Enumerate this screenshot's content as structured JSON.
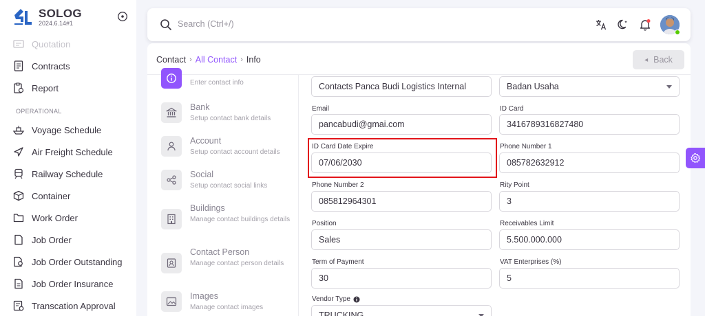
{
  "brand": {
    "name": "SOLOG",
    "version": "2024.6.14#1"
  },
  "sidebar": {
    "items": [
      {
        "label": "Quotation",
        "icon": "quotation-icon"
      },
      {
        "label": "Contracts",
        "icon": "contracts-icon"
      },
      {
        "label": "Report",
        "icon": "report-icon"
      },
      {
        "label": "Voyage Schedule",
        "icon": "ship-icon"
      },
      {
        "label": "Air Freight Schedule",
        "icon": "plane-icon"
      },
      {
        "label": "Railway Schedule",
        "icon": "train-icon"
      },
      {
        "label": "Container",
        "icon": "container-icon"
      },
      {
        "label": "Work Order",
        "icon": "folder-icon"
      },
      {
        "label": "Job Order",
        "icon": "file-icon"
      },
      {
        "label": "Job Order Outstanding",
        "icon": "file-search-icon"
      },
      {
        "label": "Job Order Insurance",
        "icon": "file-text-icon"
      },
      {
        "label": "Transcation Approval",
        "icon": "approval-icon"
      }
    ],
    "section_operational": "OPERATIONAL"
  },
  "search": {
    "placeholder": "Search (Ctrl+/)"
  },
  "breadcrumb": {
    "root": "Contact",
    "link": "All Contact",
    "current": "Info"
  },
  "back_label": "Back",
  "steps": [
    {
      "title": "",
      "desc": "Enter contact info"
    },
    {
      "title": "Bank",
      "desc": "Setup contact bank details"
    },
    {
      "title": "Account",
      "desc": "Setup contact account details"
    },
    {
      "title": "Social",
      "desc": "Setup contact social links"
    },
    {
      "title": "Buildings",
      "desc": "Manage contact buildings details"
    },
    {
      "title": "Contact Person",
      "desc": "Manage contact person details"
    },
    {
      "title": "Images",
      "desc": "Manage contact images"
    }
  ],
  "form": {
    "name_value": "Contacts Panca Budi Logistics Internal",
    "entity_value": "Badan Usaha",
    "email_label": "Email",
    "email_value": "pancabudi@gmai.com",
    "idcard_label": "ID Card",
    "idcard_value": "3416789316827480",
    "idcard_expire_label": "ID Card Date Expire",
    "idcard_expire_value": "07/06/2030",
    "phone1_label": "Phone Number 1",
    "phone1_value": "085782632912",
    "phone2_label": "Phone Number 2",
    "phone2_value": "085812964301",
    "rity_label": "Rity Point",
    "rity_value": "3",
    "position_label": "Position",
    "position_value": "Sales",
    "receivables_label": "Receivables Limit",
    "receivables_value": "5.500.000.000",
    "term_label": "Term of Payment",
    "term_value": "30",
    "vat_label": "VAT Enterprises (%)",
    "vat_value": "5",
    "vendor_label": "Vendor Type",
    "vendor_value": "TRUCKING"
  },
  "colors": {
    "primary": "#9155fd",
    "highlight": "#e2141a",
    "online": "#56ca00"
  }
}
